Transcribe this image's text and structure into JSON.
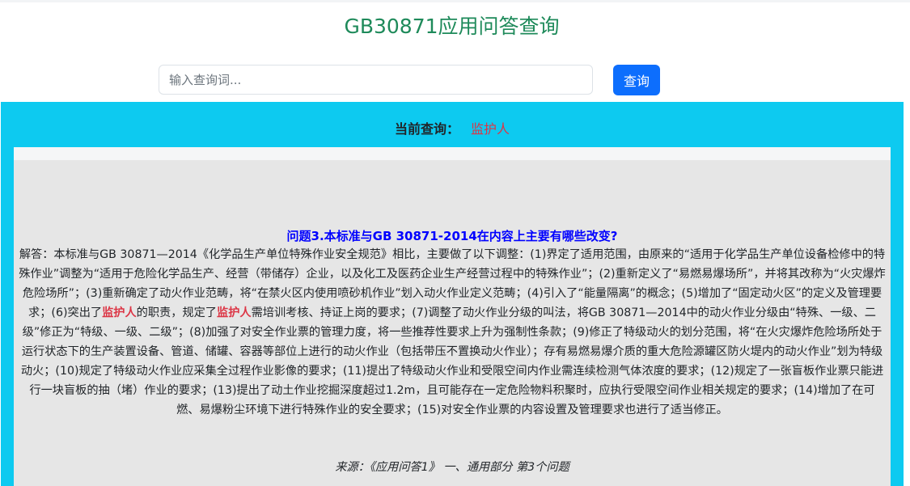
{
  "page": {
    "title": "GB30871应用问答查询"
  },
  "search": {
    "placeholder": "输入查询词...",
    "value": "",
    "button_label": "查询"
  },
  "current_query": {
    "label": "当前查询：",
    "value": "监护人"
  },
  "result": {
    "question": "问题3.本标准与GB 30871-2014在内容上主要有哪些改变?",
    "answer_segments": [
      "解答：本标准与GB 30871—2014《化学品生产单位特殊作业安全规范》相比，主要做了以下调整：(1)界定了适用范围，由原来的“适用于化学品生产单位设备检修中的特殊作业”调整为“适用于危险化学品生产、经营（带储存）企业，以及化工及医药企业生产经营过程中的特殊作业”；(2)重新定义了“易燃易爆场所”，并将其改称为“火灾爆炸危险场所”；(3)重新确定了动火作业范畴，将“在禁火区内使用喷砂机作业”划入动火作业定义范畴；(4)引入了“能量隔离”的概念；(5)增加了“固定动火区”的定义及管理要求；(6)突出了",
      "的职责，规定了",
      "需培训考核、持证上岗的要求；(7)调整了动火作业分级的叫法，将GB 30871—2014中的动火作业分级由“特殊、一级、二级”修正为“特级、一级、二级”；(8)加强了对安全作业票的管理力度，将一些推荐性要求上升为强制性条款；(9)修正了特级动火的划分范围，将“在火灾爆炸危险场所处于运行状态下的生产装置设备、管道、储罐、容器等部位上进行的动火作业（包括带压不置换动火作业）；存有易燃易爆介质的重大危险源罐区防火堤内的动火作业”划为特级动火；(10)规定了特级动火作业应采集全过程作业影像的要求；(11)提出了特级动火作业和受限空间内作业需连续检测气体浓度的要求；(12)规定了一张盲板作业票只能进行一块盲板的抽（堵）作业的要求；(13)提出了动土作业挖掘深度超过1.2m，且可能存在一定危险物料积聚时，应执行受限空间作业相关规定的要求；(14)增加了在可燃、易爆粉尘环境下进行特殊作业的安全要求；(15)对安全作业票的内容设置及管理要求也进行了适当修正。"
    ],
    "highlight_term": "监护人",
    "source": "来源：《应用问答1》 一、通用部分 第3个问题"
  },
  "colors": {
    "title": "#1e8a5a",
    "button": "#0d6efd",
    "panel": "#0dcaf0",
    "card": "#e6e6e6",
    "highlight": "#dc3545",
    "question": "#0000ff"
  }
}
